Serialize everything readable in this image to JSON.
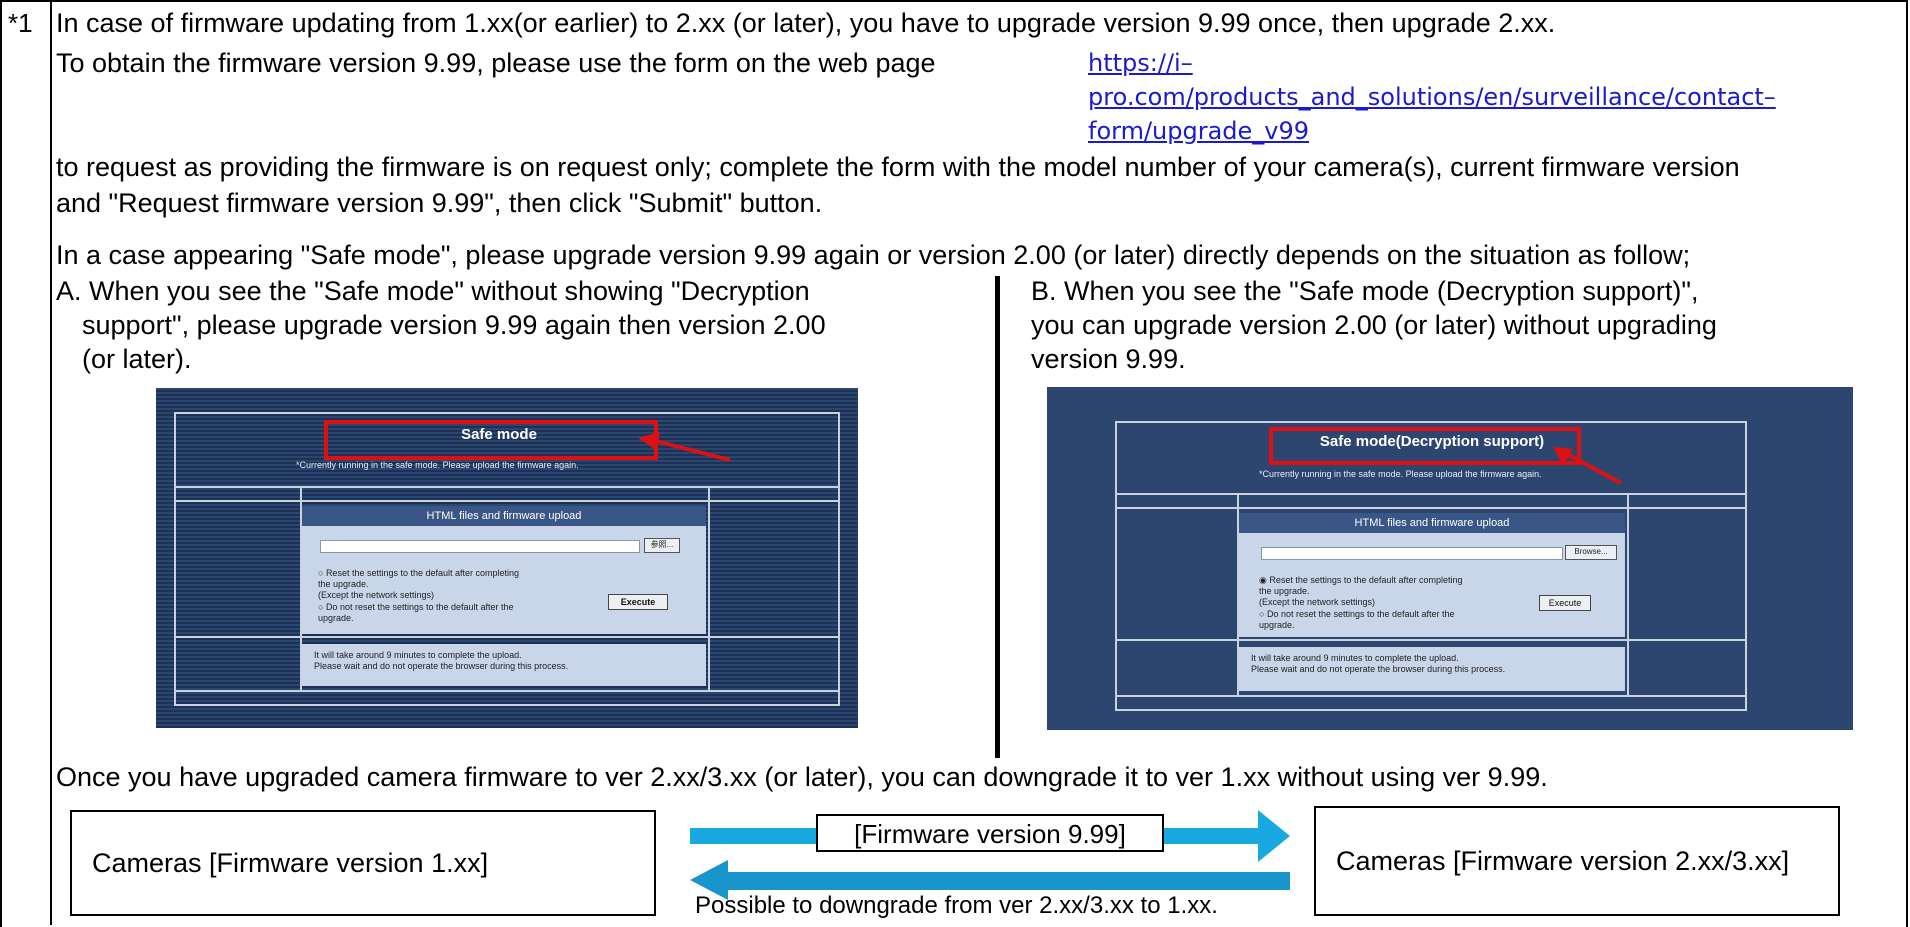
{
  "note_marker": "*1",
  "para1": "In case of firmware updating from 1.xx(or earlier) to 2.xx (or later), you have to upgrade version 9.99 once, then upgrade 2.xx.",
  "para2_lead": "To obtain the firmware version 9.99, please use the form on the web page",
  "link_lines": [
    "https://i–",
    "pro.com/products_and_solutions/en/surveillance/contact–",
    "form/upgrade_v99"
  ],
  "para3_line1": "to request as providing the firmware is on request only; complete the form with the model number of your camera(s), current firmware version",
  "para3_line2": "and \"Request firmware version 9.99\", then click \"Submit\" button.",
  "para4": "In a case appearing \"Safe  mode\", please upgrade version 9.99 again or version 2.00 (or later) directly depends on the situation as follow;",
  "case_a": {
    "lines": [
      "A. When you see the \"Safe mode\" without showing \"Decryption",
      "support\", please upgrade version 9.99 again then version 2.00",
      "(or later)."
    ],
    "screen": {
      "title": "Safe mode",
      "note": "*Currently running in the safe mode. Please upload the firmware again.",
      "upload_header": "HTML files and firmware upload",
      "browse_label": "参照...",
      "option1": [
        "Reset the settings to the default after completing",
        "the upgrade.",
        "(Except the network settings)"
      ],
      "option2": [
        "Do not reset the settings to the default after the",
        "upgrade."
      ],
      "execute_label": "Execute",
      "wait_lines": [
        "It will take around 9 minutes to complete the upload.",
        "Please wait and do not operate the browser during this process."
      ]
    }
  },
  "case_b": {
    "lines": [
      "B. When you see the \"Safe mode (Decryption support)\",",
      "you can upgrade version 2.00 (or later) without upgrading",
      "version 9.99."
    ],
    "screen": {
      "title": "Safe mode(Decryption support)",
      "note": "*Currently running in the safe mode. Please upload the firmware again.",
      "upload_header": "HTML files and firmware upload",
      "browse_label": "Browse...",
      "option1": [
        "Reset the settings to the default after completing",
        "the upgrade.",
        "(Except the network settings)"
      ],
      "option2": [
        "Do not reset the settings to the default after the",
        "upgrade."
      ],
      "execute_label": "Execute",
      "wait_lines": [
        "It will take around 9 minutes to complete the upload.",
        "Please wait and do not operate the browser during this process."
      ]
    }
  },
  "para5": "Once you have upgraded camera firmware to ver 2.xx/3.xx (or later), you can downgrade it to ver 1.xx without using ver 9.99.",
  "diagram": {
    "left_box": "Cameras [Firmware version 1.xx]",
    "right_box": "Cameras [Firmware version 2.xx/3.xx]",
    "arrow_label": "[Firmware version 9.99]",
    "downgrade_note": "Possible to downgrade from ver 2.xx/3.xx to 1.xx.",
    "arrow_color_upper": "#1aa8e0",
    "arrow_color_lower": "#1896cc"
  }
}
